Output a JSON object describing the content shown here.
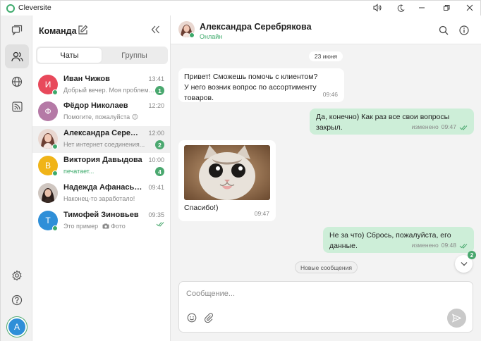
{
  "app": {
    "title": "Cleversite"
  },
  "colors": {
    "accent": "#3daa6b",
    "outgoing_bubble": "#cdeed8",
    "badge": "#4aa86f"
  },
  "rail": {
    "items": [
      {
        "icon": "chat-bubbles-icon"
      },
      {
        "icon": "team-icon",
        "active": true
      },
      {
        "icon": "globe-icon"
      },
      {
        "icon": "rss-icon"
      }
    ],
    "bottom": [
      {
        "icon": "gear-icon"
      },
      {
        "icon": "help-icon"
      }
    ],
    "me_initial": "А"
  },
  "list": {
    "title": "Команда",
    "tabs": {
      "chats": "Чаты",
      "groups": "Группы"
    },
    "chats": [
      {
        "name": "Иван Чижов",
        "initial": "И",
        "color": "#e8495b",
        "time": "13:41",
        "preview": "Добрый вечер. Моя проблема...",
        "badge": "1",
        "online": true
      },
      {
        "name": "Фёдор Николаев",
        "initial": "Ф",
        "color": "#b57aa6",
        "time": "12:20",
        "preview": "Помогите, пожалуйста 😉",
        "badge": "",
        "online": false
      },
      {
        "name": "Александра Серебряк...",
        "initial": "",
        "color": "#c98e8e",
        "time": "12:00",
        "preview": "Нет интернет соединения...",
        "badge": "2",
        "online": true
      },
      {
        "name": "Виктория Давыдова",
        "initial": "В",
        "color": "#f0b418",
        "time": "10:00",
        "preview": "печатает...",
        "badge": "4",
        "online": true
      },
      {
        "name": "Надежда Афанасьева",
        "initial": "",
        "color": "#5b4b45",
        "time": "09:41",
        "preview": "Наконец-то заработало!",
        "badge": "",
        "online": false
      },
      {
        "name": "Тимофей Зиновьев",
        "initial": "Т",
        "color": "#2f8fd8",
        "time": "09:35",
        "preview": "Это пример",
        "preview_extra": "Фото",
        "badge": "",
        "online": true
      }
    ]
  },
  "conversation": {
    "contact_name": "Александра Серебрякова",
    "status": "Онлайн",
    "date": "23 июня",
    "messages": [
      {
        "dir": "in",
        "line1": "Привет! Сможешь помочь с клиентом?",
        "line2": "У него возник вопрос по ассортименту товаров.",
        "time": "09:46"
      },
      {
        "dir": "out",
        "text": "Да, конечно) Как раз все свои вопросы закрыл.",
        "edited": "изменено",
        "time": "09:47"
      },
      {
        "dir": "in",
        "caption": "Спасибо!)",
        "time": "09:47"
      },
      {
        "dir": "out",
        "text": "Не за что) Сбрось, пожалуйста, его данные.",
        "edited": "изменено",
        "time": "09:48"
      }
    ],
    "new_messages_label": "Новые сообщения",
    "scroll_badge": "2",
    "composer_placeholder": "Сообщение..."
  }
}
